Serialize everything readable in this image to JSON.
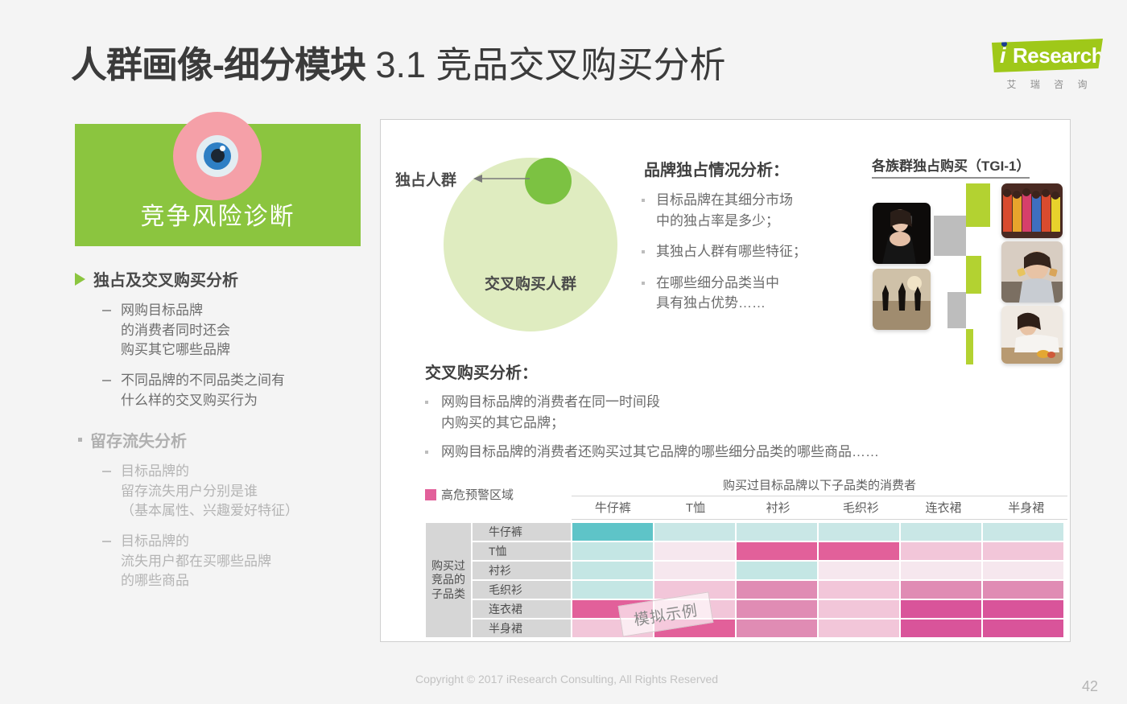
{
  "slide": {
    "title_main": "人群画像-细分模块",
    "title_sub": " 3.1 竞品交叉购买分析",
    "page_number": "42",
    "footer": "Copyright © 2017 iResearch Consulting, All Rights Reserved",
    "background": "#f4f4f4"
  },
  "logo": {
    "letter_i": "i",
    "word": "Research",
    "chinese": "艾 瑞 咨 询",
    "brand_green": "#9fc819",
    "dot_blue": "#1b3d8f"
  },
  "left": {
    "card_label": "竞争风险诊断",
    "card_color": "#8bc53f",
    "eye_ring_color": "#f5a0a8",
    "groups": [
      {
        "title": "独占及交叉购买分析",
        "active": true,
        "items": [
          "网购目标品牌\n的消费者同时还会\n购买其它哪些品牌",
          "不同品牌的不同品类之间有\n什么样的交叉购买行为"
        ]
      },
      {
        "title": "留存流失分析",
        "active": false,
        "items": [
          "目标品牌的\n留存流失用户分别是谁\n（基本属性、兴趣爱好特征）",
          "目标品牌的\n流失用户都在买哪些品牌\n的哪些商品"
        ]
      }
    ]
  },
  "venn": {
    "big_label": "交叉购买人群",
    "small_label": "独占人群",
    "big_color": "#dfecc0",
    "small_color": "#7cc242"
  },
  "exclusivity": {
    "heading": "品牌独占情况分析：",
    "items": [
      "目标品牌在其细分市场\n中的独占率是多少；",
      "其独占人群有哪些特征；",
      "在哪些细分品类当中\n具有独占优势……"
    ]
  },
  "tgi": {
    "heading": "各族群独占购买（TGI-1）",
    "green": "#b3d231",
    "gray": "#bdbdbd"
  },
  "cross": {
    "heading": "交叉购买分析：",
    "items": [
      "网购目标品牌的消费者在同一时间段\n内购买的其它品牌；",
      "网购目标品牌的消费者还购买过其它品牌的哪些细分品类的哪些商品……"
    ]
  },
  "chart_data": {
    "type": "heatmap",
    "title": "购买过目标品牌以下子品类的消费者",
    "row_axis_title": "购买过\n竞品的\n子品类",
    "legend_label": "高危预警区域",
    "legend_color": "#e2609a",
    "watermark": "模拟示例",
    "categories": [
      "牛仔裤",
      "T恤",
      "衬衫",
      "毛织衫",
      "连衣裙",
      "半身裙"
    ],
    "rows": [
      "牛仔裤",
      "T恤",
      "衬衫",
      "毛织衫",
      "连衣裙",
      "半身裙"
    ],
    "cells": [
      [
        "#5ec4c8",
        "#c9e7e6",
        "#c9e7e6",
        "#c9e7e6",
        "#c9e7e6",
        "#c9e7e6"
      ],
      [
        "#c4e6e4",
        "#f6e7ee",
        "#e2609a",
        "#e2609a",
        "#f2c6d9",
        "#f2c6d9"
      ],
      [
        "#c4e6e4",
        "#f6e7ee",
        "#c4e6e4",
        "#f6e7ee",
        "#f6e7ee",
        "#f6e7ee"
      ],
      [
        "#c4e6e4",
        "#f2c6d9",
        "#e08cb4",
        "#f2c6d9",
        "#e08cb4",
        "#e08cb4"
      ],
      [
        "#e2609a",
        "#f2c6d9",
        "#e08cb4",
        "#f2c6d9",
        "#d9549a",
        "#d9549a"
      ],
      [
        "#f2c6d9",
        "#e2609a",
        "#e08cb4",
        "#f2c6d9",
        "#d9549a",
        "#d9549a"
      ]
    ]
  }
}
